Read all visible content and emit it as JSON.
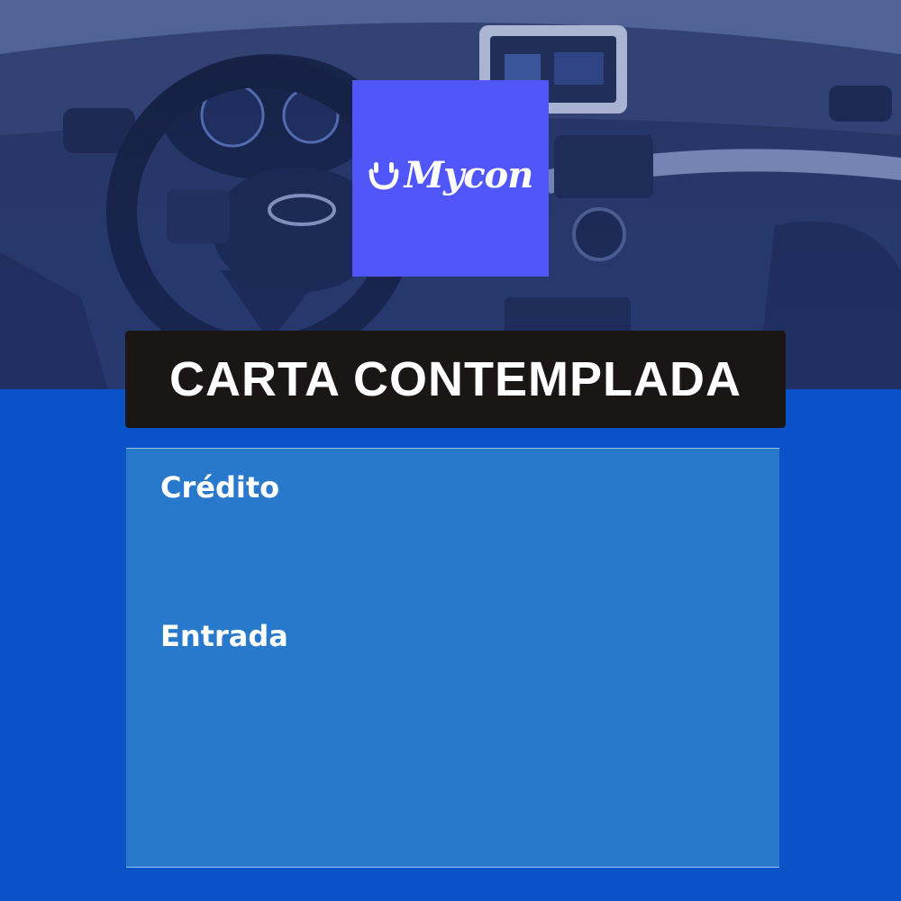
{
  "brand": {
    "name": "Mycon",
    "tile_color": "#5156fb",
    "icon": "smile-icon"
  },
  "title": "CARTA CONTEMPLADA",
  "fields": {
    "credito_label": "Crédito",
    "entrada_label": "Entrada"
  },
  "colors": {
    "background": "#0a52c8",
    "card": "#2878cc",
    "title_bar": "#1b1616",
    "text": "#ffffff"
  }
}
